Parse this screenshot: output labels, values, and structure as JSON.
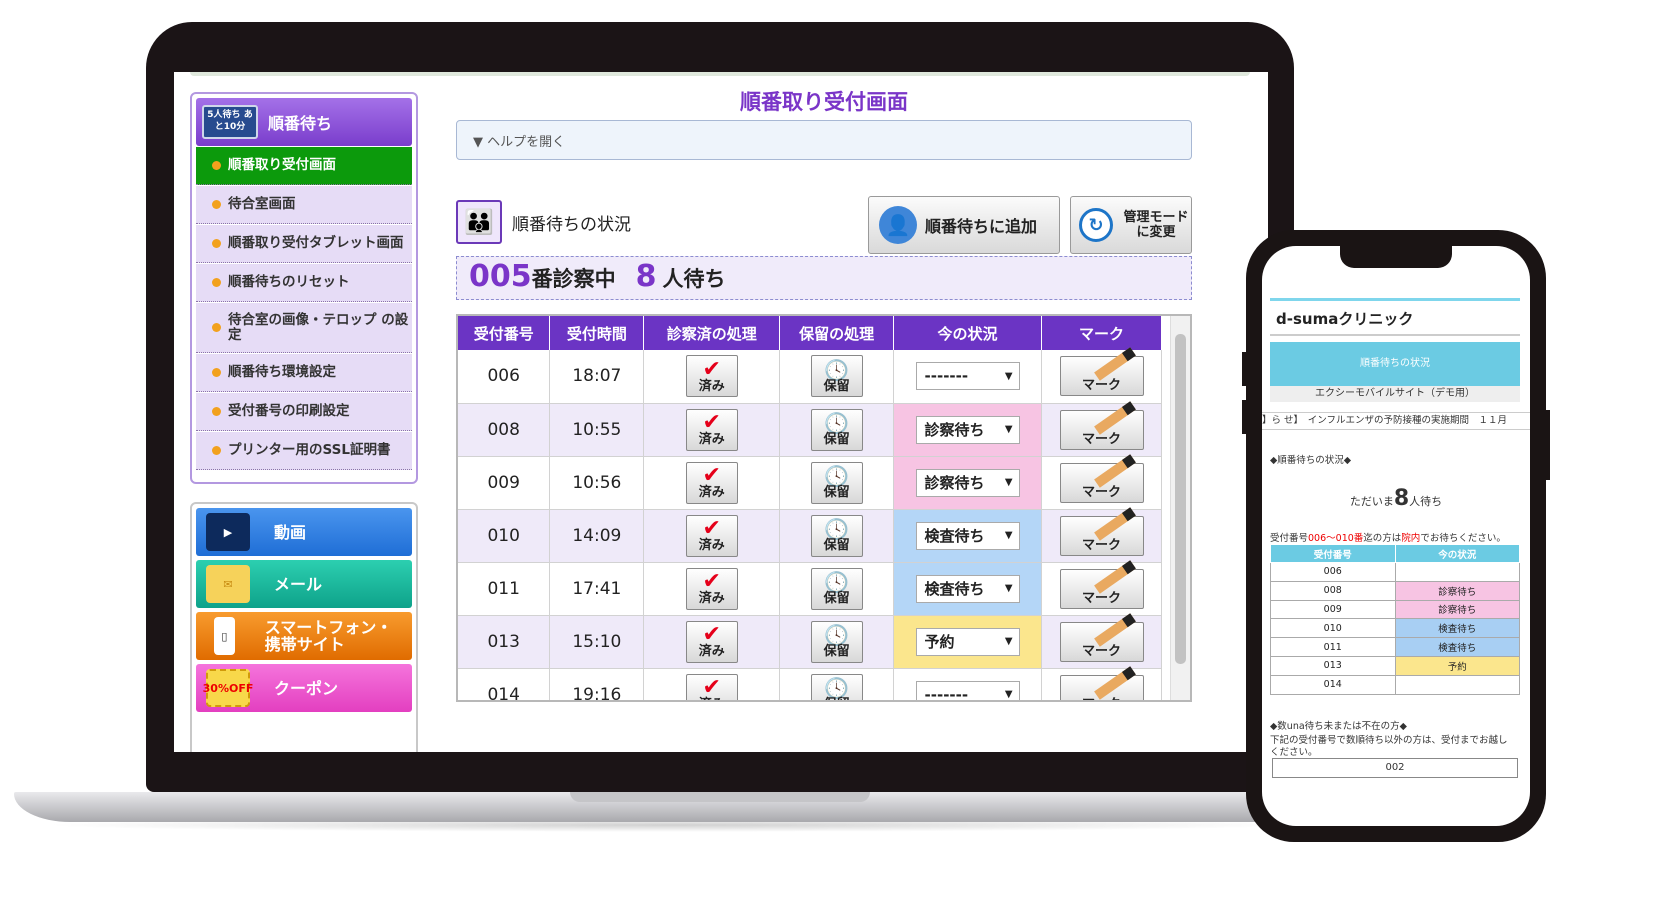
{
  "sidebar": {
    "header_icon_text": "5人待ち あと10分",
    "header_label": "順番待ち",
    "items": [
      {
        "label": "順番取り受付画面",
        "active": true
      },
      {
        "label": "待合室画面"
      },
      {
        "label": "順番取り受付タブレット画面"
      },
      {
        "label": "順番待ちのリセット"
      },
      {
        "label": "待合室の画像・テロップ の設定"
      },
      {
        "label": "順番待ち環境設定"
      },
      {
        "label": "受付番号の印刷設定"
      },
      {
        "label": "プリンター用のSSL証明書"
      }
    ],
    "big_buttons": [
      {
        "label": "動画",
        "color": "#2f7de0"
      },
      {
        "label": "メール",
        "color": "#14b59a"
      },
      {
        "label": "スマートフォン・ 携帯サイト",
        "color": "#f07d0c"
      },
      {
        "label": "クーポン",
        "color": "#ee56cc",
        "icon_text": "30%OFF"
      }
    ]
  },
  "main": {
    "title": "順番取り受付画面",
    "help_label": "▼ ヘルプを開く",
    "status_label": "順番待ちの状況",
    "add_button": "順番待ちに追加",
    "mode_button": "管理モード に変更",
    "current_number": "005",
    "current_suffix": "番診察中",
    "waiting_count": "8",
    "waiting_suffix": "人待ち",
    "columns": [
      "受付番号",
      "受付時間",
      "診察済の処理",
      "保留の処理",
      "今の状況",
      "マーク"
    ],
    "done_label": "済み",
    "hold_label": "保留",
    "mark_label": "マーク",
    "rows": [
      {
        "number": "006",
        "time": "18:07",
        "status": "-------",
        "tone": ""
      },
      {
        "number": "008",
        "time": "10:55",
        "status": "診察待ち",
        "tone": "pink"
      },
      {
        "number": "009",
        "time": "10:56",
        "status": "診察待ち",
        "tone": "pink"
      },
      {
        "number": "010",
        "time": "14:09",
        "status": "検査待ち",
        "tone": "blue"
      },
      {
        "number": "011",
        "time": "17:41",
        "status": "検査待ち",
        "tone": "blue"
      },
      {
        "number": "013",
        "time": "15:10",
        "status": "予約",
        "tone": "yel"
      },
      {
        "number": "014",
        "time": "19:16",
        "status": "-------",
        "tone": ""
      }
    ]
  },
  "phone": {
    "clinic_name": "d-sumaクリニック",
    "cyan_label": "順番待ちの状況",
    "subtitle": "エクシーモバイルサイト（デモ用）",
    "ticker": "】ら せ】　インフルエンザの予防接種の実施期間　１１月",
    "section_label": "◆順番待ちの状況◆",
    "now_prefix": "ただいま",
    "now_count": "8",
    "now_suffix": "人待ち",
    "note_prefix": "受付番号",
    "note_range": "006〜010番",
    "note_mid": "迄の方は",
    "note_place": "院内",
    "note_suffix": "でお待ちください。",
    "col_number": "受付番号",
    "col_status": "今の状況",
    "rows": [
      {
        "number": "006",
        "status": "",
        "tone": ""
      },
      {
        "number": "008",
        "status": "診察待ち",
        "tone": "pp"
      },
      {
        "number": "009",
        "status": "診察待ち",
        "tone": "pp"
      },
      {
        "number": "010",
        "status": "検査待ち",
        "tone": "pb"
      },
      {
        "number": "011",
        "status": "検査待ち",
        "tone": "pb"
      },
      {
        "number": "013",
        "status": "予約",
        "tone": "py"
      },
      {
        "number": "014",
        "status": "",
        "tone": ""
      }
    ],
    "absent_label": "◆数una待ち未または不在の方◆",
    "absent_text1": "下記の受付番号で数順待ち以外の方は、受付までお越し",
    "absent_text2": "ください。",
    "absent_value": "002"
  }
}
